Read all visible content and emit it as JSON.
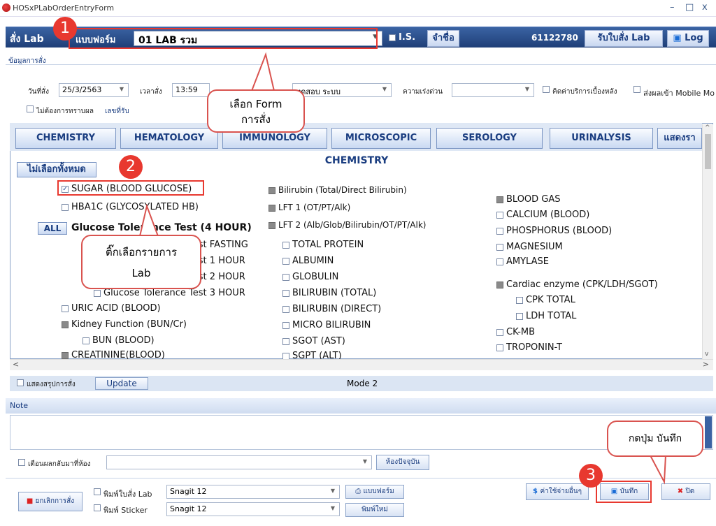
{
  "window": {
    "title": "HOSxPLabOrderEntryForm",
    "min": "–",
    "max": "□",
    "close": "x"
  },
  "header": {
    "title": "สั่ง Lab",
    "form_label": "แบบฟอร์ม",
    "form_value": "01 LAB รวม",
    "is_label": "I.S.",
    "remember_btn": "จำชื่อ",
    "hn": "61122780",
    "receive_btn": "รับใบสั่ง Lab",
    "log_btn": "Log"
  },
  "order_info": {
    "section_label": "ข้อมูลการสั่ง",
    "date_label": "วันที่สั่ง",
    "date_value": "25/3/2563",
    "time_label": "เวลาสั่ง",
    "time_value": "13:59",
    "doctor_value": "ทดสอบ ระบบ",
    "urgency_label": "ความเร่งด่วน",
    "urgency_value": "",
    "charge_label": "คิดค่าบริการเบื้องหลัง",
    "mobile_label": "ส่งผลเข้า Mobile Mo",
    "notify_label": "ไม่ต้องการทราบผล",
    "receive_no_label": "เลขที่รับ"
  },
  "tabs": [
    "CHEMISTRY",
    "HEMATOLOGY",
    "IMMUNOLOGY",
    "MICROSCOPIC",
    "SEROLOGY",
    "URINALYSIS",
    "แสดงรา"
  ],
  "panel": {
    "deselect_btn": "ไม่เลือกทั้งหมด",
    "category": "CHEMISTRY",
    "all_btn": "ALL",
    "col1": [
      "SUGAR (BLOOD GLUCOSE)",
      "HBA1C (GLYCOSYLATED HB)",
      "Glucose Tolerance Test (4 HOUR)",
      "Glucose Tolerance Test FASTING",
      "Glucose Tolerance Test 1 HOUR",
      "Glucose Tolerance Test 2 HOUR",
      "Glucose Tolerance Test 3 HOUR",
      "URIC ACID (BLOOD)",
      "Kidney Function (BUN/Cr)",
      "BUN (BLOOD)",
      "CREATININE(BLOOD)"
    ],
    "col2": [
      "Bilirubin (Total/Direct Bilirubin)",
      "LFT 1 (OT/PT/Alk)",
      "LFT 2 (Alb/Glob/Bilirubin/OT/PT/Alk)",
      "TOTAL PROTEIN",
      "ALBUMIN",
      "GLOBULIN",
      "BILIRUBIN (TOTAL)",
      "BILIRUBIN (DIRECT)",
      "MICRO BILIRUBIN",
      "SGOT (AST)",
      "SGPT (ALT)"
    ],
    "col3": [
      "BLOOD GAS",
      "CALCIUM (BLOOD)",
      "PHOSPHORUS (BLOOD)",
      "MAGNESIUM",
      "AMYLASE",
      "Cardiac enzyme (CPK/LDH/SGOT)",
      "CPK TOTAL",
      "LDH TOTAL",
      "CK-MB",
      "TROPONIN-T"
    ]
  },
  "summary": {
    "show_label": "แสดงสรุปการสั่ง",
    "update_btn": "Update",
    "mode": "Mode 2"
  },
  "note": {
    "header": "Note",
    "alert_label": "เตือนผลกลับมาที่ห้อง",
    "room_btn": "ห้องปัจจุบัน"
  },
  "footer": {
    "cancel_btn": "ยกเลิกการสั่ง",
    "print_lab_label": "พิมพ์ใบสั่ง Lab",
    "print_lab_value": "Snagit 12",
    "form_btn": "แบบฟอร์ม",
    "print_sticker_label": "พิมพ์ Sticker",
    "print_sticker_value": "Snagit 12",
    "reprint_btn": "พิมพ์ใหม่",
    "other_cost_btn": "ค่าใช้จ่ายอื่นๆ",
    "save_btn": "บันทึก",
    "close_btn": "ปิด"
  },
  "annotations": {
    "badge1": "1",
    "badge2": "2",
    "badge3": "3",
    "callout1_line1": "เลือก Form",
    "callout1_line2": "การสั่ง",
    "callout2_line1": "ติ๊กเลือกรายการ",
    "callout2_line2": "Lab",
    "callout3": "กดปุ่ม บันทึก"
  },
  "colors": {
    "header": "#2a4f8f",
    "accent": "#e8382f",
    "tab_text": "#1a3d80"
  }
}
